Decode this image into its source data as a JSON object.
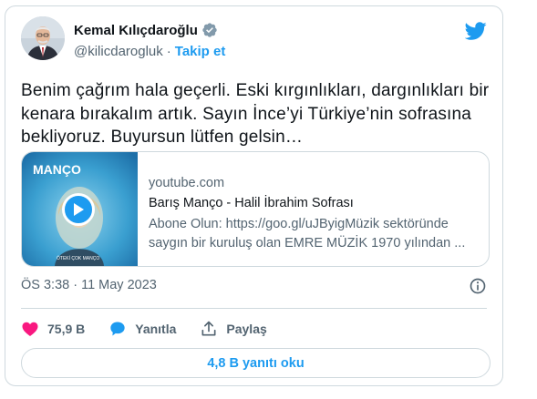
{
  "author": {
    "name": "Kemal Kılıçdaroğlu",
    "handle": "@kilicdarogluk",
    "separator": "·",
    "follow_label": "Takip et"
  },
  "tweet": {
    "text": "Benim çağrım hala geçerli. Eski kırgınlıkları, dargınlıkları bir kenara bırakalım artık. Sayın İnce’yi Türkiye’nin sofrasına bekliyoruz. Buyursun lütfen gelsin…"
  },
  "link_preview": {
    "domain": "youtube.com",
    "title": "Barış Manço - Halil İbrahim Sofrası",
    "description": "Abone Olun: https://goo.gl/uJByigMüzik sektöründe saygın bir kuruluş olan EMRE MÜZİK 1970 yılından ...",
    "thumbnail_text": "MANÇO",
    "thumbnail_subtext": "ÖTEKİ ÇOK MANÇO"
  },
  "timestamp": "ÖS 3:38 · 11 May 2023",
  "actions": {
    "likes": "75,9 B",
    "reply_label": "Yanıtla",
    "share_label": "Paylaş"
  },
  "read_replies_label": "4,8 B yanıtı oku",
  "colors": {
    "accent": "#1d9bf0",
    "like": "#f91880",
    "text": "#0f1419",
    "muted": "#536471",
    "border": "#cfd9de"
  },
  "icons": [
    "verified-badge-icon",
    "twitter-bird-icon",
    "play-icon",
    "info-icon",
    "heart-icon",
    "reply-bubble-icon",
    "share-icon"
  ]
}
